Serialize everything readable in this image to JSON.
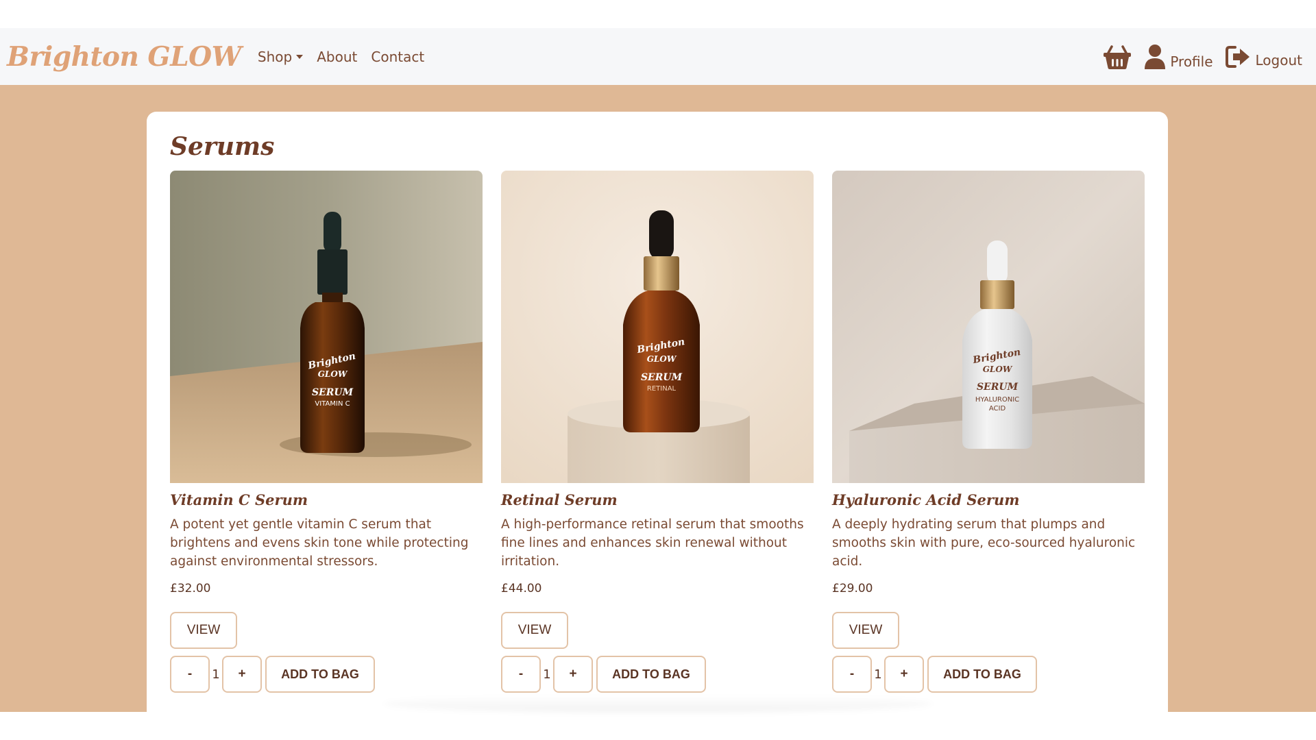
{
  "brand": {
    "name": "Brighton GLOW",
    "color": "#dfa277"
  },
  "nav": {
    "shop_label": "Shop",
    "about_label": "About",
    "contact_label": "Contact",
    "profile_label": "Profile",
    "logout_label": "Logout",
    "icons": [
      "basket-icon",
      "user-icon",
      "logout-icon"
    ]
  },
  "page": {
    "title": "Serums"
  },
  "colors": {
    "accent": "#7a4a33",
    "backdrop": "#dfb895",
    "button_border": "#e3c3a7"
  },
  "products": [
    {
      "name": "Vitamin C Serum",
      "description": "A potent yet gentle vitamin C serum that brightens and evens skin tone while protecting against environmental stressors.",
      "price": "£32.00",
      "view_label": "VIEW",
      "qty_minus": "-",
      "qty": "1",
      "qty_plus": "+",
      "add_label": "ADD TO BAG",
      "label_brand1": "Brighton",
      "label_brand2": "GLOW",
      "label_type": "SERUM",
      "label_variant": "VITAMIN C"
    },
    {
      "name": "Retinal Serum",
      "description": "A high-performance retinal serum that smooths fine lines and enhances skin renewal without irritation.",
      "price": "£44.00",
      "view_label": "VIEW",
      "qty_minus": "-",
      "qty": "1",
      "qty_plus": "+",
      "add_label": "ADD TO BAG",
      "label_brand1": "Brighton",
      "label_brand2": "GLOW",
      "label_type": "SERUM",
      "label_variant": "RETINAL"
    },
    {
      "name": "Hyaluronic Acid Serum",
      "description": "A deeply hydrating serum that plumps and smooths skin with pure, eco-sourced hyaluronic acid.",
      "price": "£29.00",
      "view_label": "VIEW",
      "qty_minus": "-",
      "qty": "1",
      "qty_plus": "+",
      "add_label": "ADD TO BAG",
      "label_brand1": "Brighton",
      "label_brand2": "GLOW",
      "label_type": "SERUM",
      "label_variant1": "HYALURONIC",
      "label_variant2": "ACID"
    }
  ]
}
